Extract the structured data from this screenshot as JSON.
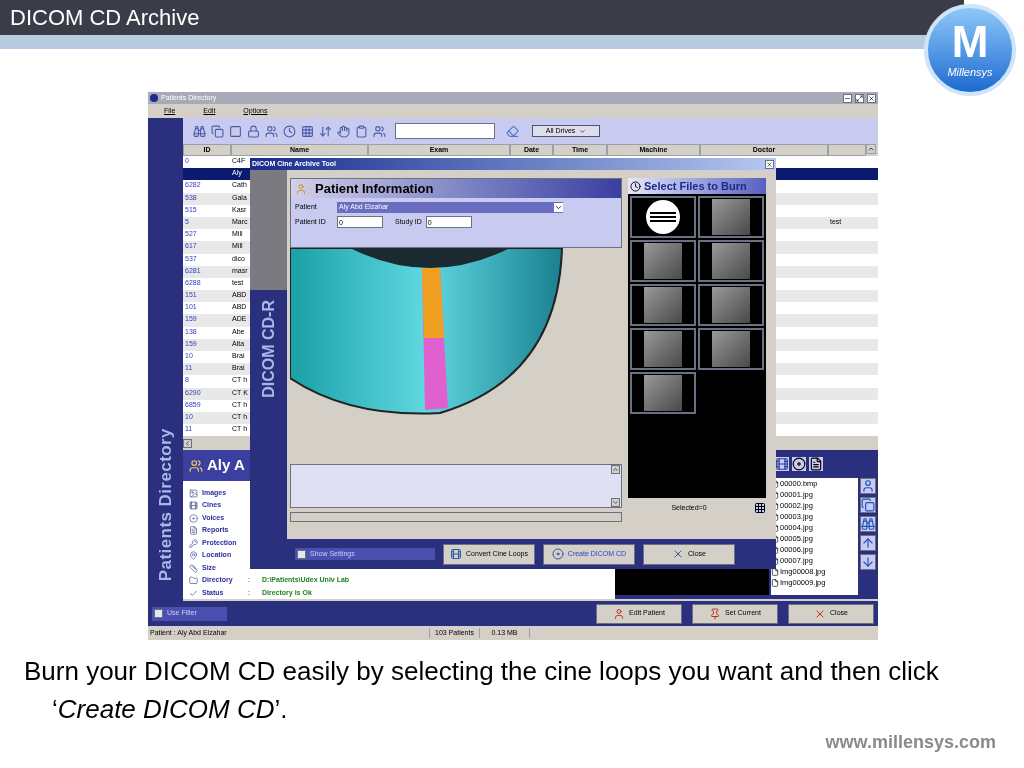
{
  "slide": {
    "title": "DICOM CD Archive",
    "logo": {
      "letter": "M",
      "name": "Millensys"
    },
    "caption": "Burn your DICOM CD easily by selecting the cine loops you want and then click ‘*Create DICOM CD*’.",
    "url": "www.millensys.com"
  },
  "main_window": {
    "title": "Patients Directory",
    "menu": [
      "File",
      "Edit",
      "Options"
    ],
    "side_title": "Patients Directory",
    "drive_select": "All Drives",
    "table": {
      "columns": [
        "ID",
        "Name",
        "Exam",
        "Date",
        "Time",
        "Machine",
        "Doctor"
      ],
      "rows": [
        {
          "id": "0",
          "name": "C4F",
          "selected": false
        },
        {
          "name": "Aly",
          "selected": true
        },
        {
          "id": "6282",
          "name": "Cath",
          "selected": false
        },
        {
          "id": "538",
          "name": "Gala",
          "selected": false
        },
        {
          "id": "515",
          "name": "Kasr",
          "selected": false
        },
        {
          "id": "5",
          "name": "Marc",
          "column_8": "test",
          "selected": false
        },
        {
          "id": "527",
          "name": "Mill",
          "selected": false
        },
        {
          "id": "617",
          "name": "Mill",
          "selected": false
        },
        {
          "id": "537",
          "name": "dico",
          "selected": false
        },
        {
          "id": "6281",
          "name": "masr",
          "selected": false
        },
        {
          "id": "6288",
          "name": "test",
          "selected": false
        },
        {
          "id": "151",
          "name": "ABD",
          "selected": false
        },
        {
          "id": "101",
          "name": "ABD",
          "selected": false
        },
        {
          "id": "159",
          "name": "ADE",
          "selected": false
        },
        {
          "id": "138",
          "name": "Abe",
          "selected": false
        },
        {
          "id": "159",
          "name": "Alta",
          "selected": false
        },
        {
          "id": "10",
          "name": "Brai",
          "selected": false
        },
        {
          "id": "11",
          "name": "Brai",
          "selected": false
        },
        {
          "id": "8",
          "name": "CT h",
          "selected": false
        },
        {
          "id": "6290",
          "name": "CT K",
          "selected": false
        },
        {
          "id": "6859",
          "name": "CT h",
          "selected": false
        },
        {
          "id": "10",
          "name": "CT h",
          "selected": false
        },
        {
          "id": "11",
          "name": "CT h",
          "selected": false
        }
      ]
    },
    "details": {
      "heading": "Aly A",
      "properties": [
        {
          "label": "Images"
        },
        {
          "label": "Cines"
        },
        {
          "label": "Voices"
        },
        {
          "label": "Reports"
        },
        {
          "label": "Protection"
        },
        {
          "label": "Location"
        },
        {
          "label": "Size"
        },
        {
          "label": "Directory",
          "value": "D:\\Patients\\Udex Univ Lab"
        },
        {
          "label": "Status",
          "value": "Directory is Ok"
        }
      ],
      "separator": ":"
    },
    "files": [
      "00000.bmp",
      "00001.jpg",
      "00002.jpg",
      "00003.jpg",
      "00004.jpg",
      "00005.jpg",
      "00006.jpg",
      "00007.jpg",
      "Img00008.jpg",
      "Img00009.jpg"
    ],
    "use_filter": {
      "label": "Use Filter",
      "checked": false
    },
    "buttons": [
      "Edit Patient",
      "Set Current",
      "Close"
    ],
    "status_bar": [
      "Patient : Aly Abd Elzahar",
      "103 Patients",
      "0.13 MB"
    ]
  },
  "dialog": {
    "title": "DICOM Cine Archive Tool",
    "side_title": "DICOM CD-R",
    "section_title": "Patient Information",
    "patient": {
      "label": "Patient",
      "value": "Aly Abd Elzahar"
    },
    "patient_id": {
      "label": "Patient ID",
      "value": "0"
    },
    "study_id": {
      "label": "Study ID",
      "value": "0"
    },
    "files_title": "Select Files to Burn",
    "thumbnails": [
      {
        "kind": "label"
      },
      {
        "kind": "scan"
      },
      {
        "kind": "scan"
      },
      {
        "kind": "scan"
      },
      {
        "kind": "scan"
      },
      {
        "kind": "scan"
      },
      {
        "kind": "scan"
      },
      {
        "kind": "scan"
      },
      {
        "kind": "scan"
      }
    ],
    "selected_count": "Selected=0",
    "progress": {
      "level": 0
    },
    "show_settings": {
      "label": "Show Settings",
      "checked": false
    },
    "buttons": [
      "Convert Cine Loops",
      "Create DICOM CD",
      "Close"
    ]
  }
}
